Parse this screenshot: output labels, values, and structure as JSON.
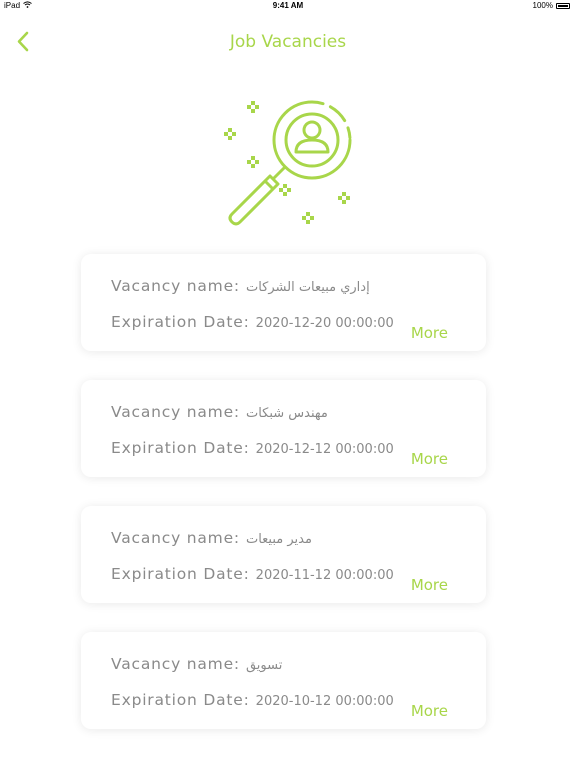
{
  "status_bar": {
    "device": "iPad",
    "time": "9:41 AM",
    "battery_percent": "100%",
    "battery_level": 1.0
  },
  "header": {
    "title": "Job Vacancies",
    "back_icon": "chevron-left-icon"
  },
  "hero": {
    "icon": "search-person-icon"
  },
  "colors": {
    "accent": "#a8d64a",
    "text_secondary": "#8a8a8a",
    "card_background": "#ffffff"
  },
  "vacancies": [
    {
      "name_label": "Vacancy name:",
      "name": "إداري مبيعات الشركات",
      "date_label": "Expiration Date:",
      "date": "2020-12-20 00:00:00",
      "more_label": "More"
    },
    {
      "name_label": "Vacancy name:",
      "name": "مهندس شبكات",
      "date_label": "Expiration Date:",
      "date": "2020-12-12 00:00:00",
      "more_label": "More"
    },
    {
      "name_label": "Vacancy name:",
      "name": "مدير مبيعات",
      "date_label": "Expiration Date:",
      "date": "2020-11-12 00:00:00",
      "more_label": "More"
    },
    {
      "name_label": "Vacancy name:",
      "name": "تسويق",
      "date_label": "Expiration Date:",
      "date": "2020-10-12 00:00:00",
      "more_label": "More"
    }
  ]
}
